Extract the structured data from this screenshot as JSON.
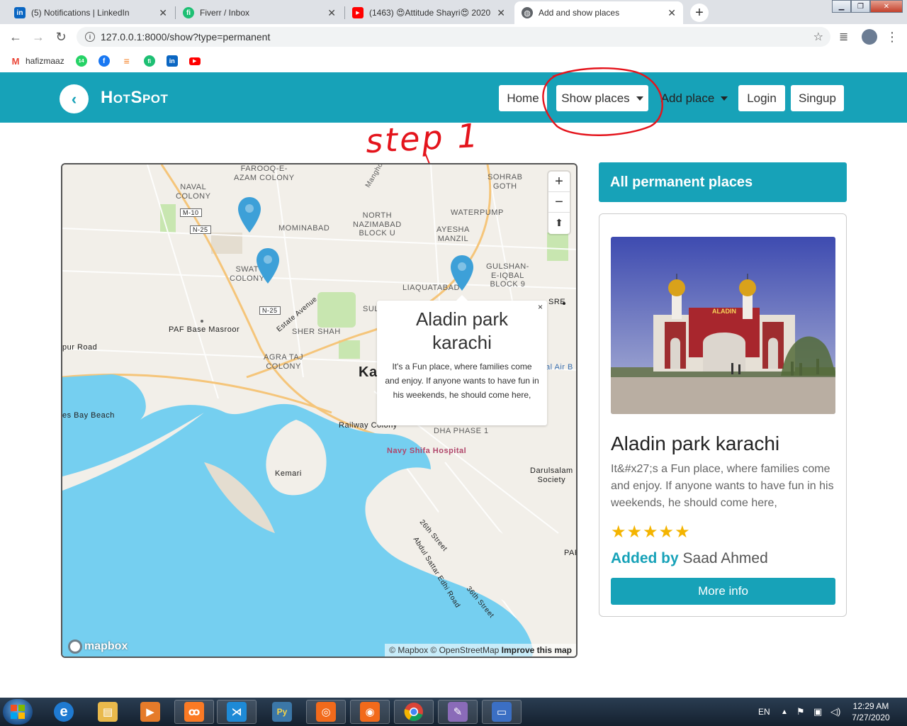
{
  "browser": {
    "tabs": [
      {
        "label": "(5) Notifications | LinkedIn",
        "icon": "linkedin-icon",
        "color": "#0a66c2",
        "glyph": "in"
      },
      {
        "label": "Fiverr / Inbox",
        "icon": "fiverr-icon",
        "color": "#1dbf73",
        "glyph": "fi"
      },
      {
        "label": "(1463) 😍Attitude Shayri😍 2020",
        "icon": "youtube-icon",
        "color": "#ff0000",
        "glyph": "▶"
      },
      {
        "label": "Add and show places",
        "icon": "globe-icon",
        "color": "#5f6368",
        "glyph": "◍"
      }
    ],
    "url": "127.0.0.1:8000/show?type=permanent",
    "bookmarks": [
      {
        "label": "hafizmaaz",
        "icon": "gmail-icon",
        "color": "#ea4335",
        "glyph": "M"
      },
      {
        "label": "",
        "icon": "whatsapp-icon",
        "color": "#25d366",
        "glyph": "14"
      },
      {
        "label": "",
        "icon": "facebook-icon",
        "color": "#1877f2",
        "glyph": "f"
      },
      {
        "label": "",
        "icon": "stackoverflow-icon",
        "color": "#f48024",
        "glyph": "≡"
      },
      {
        "label": "",
        "icon": "fiverr-icon",
        "color": "#1dbf73",
        "glyph": "fi"
      },
      {
        "label": "",
        "icon": "linkedin-icon",
        "color": "#0a66c2",
        "glyph": "in"
      },
      {
        "label": "",
        "icon": "youtube-icon",
        "color": "#ff0000",
        "glyph": "▶"
      }
    ]
  },
  "navbar": {
    "brand": "HotSpot",
    "home": "Home",
    "show_places": "Show places",
    "add_place": "Add place",
    "login": "Login",
    "signup": "Singup"
  },
  "annotation": {
    "note": "step 1",
    "color": "#e4141c"
  },
  "map": {
    "labels": {
      "farooq": "FAROOQ-E-\nAZAM COLONY",
      "naval": "NAVAL\nCOLONY",
      "manghopir": "Manghopir",
      "sohrab": "SOHRAB\nGOTH",
      "waterpump": "WATERPUMP",
      "nnazimabad": "NORTH\nNAZIMABAD\nBLOCK U",
      "mominabad": "MOMINABAD",
      "ayesha": "AYESHA\nMANZIL",
      "swat": "SWAT\nCOLONY",
      "gulshan": "GULSHAN-\nE-IQBAL\nBLOCK 9",
      "liaquatabad": "LIAQUATABAD",
      "pafbase": "PAF Base Masroor",
      "shershah": "SHER SHAH",
      "agrataj": "AGRA TAJ\nCOLONY",
      "estate": "Estate Avenue",
      "karachi": "Ka",
      "railway": "Railway Colony",
      "dha": "DHA PHASE 1",
      "navy": "Navy Shifa Hospital",
      "kemari": "Kemari",
      "darulsalam": "Darulsalam\nSociety",
      "beach": "es Bay Beach",
      "road": "pur Road",
      "street26": "26th Street",
      "abdulsattar": "Abdul Sattar Edhi Road",
      "street36": "36th Street",
      "sre": "SRE",
      "saiair": "sal Air B",
      "sul": "SUL",
      "par": "PAR",
      "m10": "M-10",
      "n25a": "N-25",
      "n25b": "N-25"
    },
    "popup": {
      "title": "Aladin park karachi",
      "description": "It's a Fun place, where families come and enjoy. If anyone wants to have fun in his weekends, he should come here,",
      "close": "×"
    },
    "zoom_in": "+",
    "zoom_out": "−",
    "compass": "⬆",
    "logo": "mapbox",
    "attribution_text": "© Mapbox © OpenStreetMap",
    "attribution_link": "Improve this map",
    "colors": {
      "water": "#75cff0",
      "land": "#f2efe9",
      "park": "#c8e6b0",
      "road": "#ffffff",
      "arterial": "#f5c57a",
      "pin": "#3da0d8"
    }
  },
  "panel": {
    "heading": "All permanent places",
    "card": {
      "image_text": "ALADIN",
      "title": "Aladin park karachi",
      "description": "It&#x27;s a Fun place, where families come and enjoy. If anyone wants to have fun in his weekends, he should come here,",
      "rating": 5,
      "stars": "★★★★★",
      "added_by_label": "Added by",
      "added_by_name": "Saad Ahmed",
      "button": "More info"
    }
  },
  "taskbar": {
    "apps": [
      {
        "icon": "internet-explorer-icon",
        "color": "#1f7ad1",
        "glyph": "e"
      },
      {
        "icon": "file-explorer-icon",
        "color": "#e9b94b",
        "glyph": "▤"
      },
      {
        "icon": "media-player-icon",
        "color": "#e57b2a",
        "glyph": "▶"
      },
      {
        "icon": "xampp-icon",
        "color": "#fb7a24",
        "glyph": "ꝏ"
      },
      {
        "icon": "vscode-icon",
        "color": "#1e8ad6",
        "glyph": "⋊"
      },
      {
        "icon": "python-icon",
        "color": "#f3d34a",
        "glyph": "Py"
      },
      {
        "icon": "screenshot-tool-icon",
        "color": "#f26a1b",
        "glyph": "◎"
      },
      {
        "icon": "camera-icon",
        "color": "#f26a1b",
        "glyph": "◉"
      },
      {
        "icon": "chrome-icon",
        "color": "#db4437",
        "glyph": "◕"
      },
      {
        "icon": "paint-icon",
        "color": "#8a6bb8",
        "glyph": "✎"
      },
      {
        "icon": "virtual-machine-icon",
        "color": "#3b6fc4",
        "glyph": "▭"
      }
    ],
    "lang": "EN",
    "time": "12:29 AM",
    "date": "7/27/2020"
  }
}
